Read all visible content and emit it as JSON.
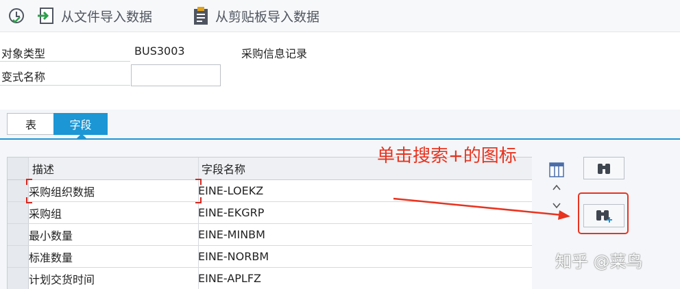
{
  "toolbar": {
    "import_file_label": "从文件导入数据",
    "import_clipboard_label": "从剪贴板导入数据",
    "icons": [
      "execute-icon",
      "import-file-icon",
      "clipboard-icon"
    ]
  },
  "form": {
    "object_type_label": "对象类型",
    "object_type_value": "BUS3003",
    "object_type_desc": "采购信息记录",
    "variant_name_label": "变式名称",
    "variant_name_value": ""
  },
  "tabs": [
    {
      "label": "表"
    },
    {
      "label": "字段",
      "active": true
    }
  ],
  "grid": {
    "columns": [
      "描述",
      "字段名称"
    ],
    "rows": [
      {
        "desc": "采购组织数据",
        "field": "EINE-LOEKZ"
      },
      {
        "desc": "采购组",
        "field": "EINE-EKGRP"
      },
      {
        "desc": "最小数量",
        "field": "EINE-MINBM"
      },
      {
        "desc": "标准数量",
        "field": "EINE-NORBM"
      },
      {
        "desc": "计划交货时间",
        "field": "EINE-APLFZ"
      }
    ]
  },
  "side_buttons": {
    "find_icon": "binoculars-icon",
    "find_next_icon": "binoculars-plus-icon"
  },
  "annotation": {
    "text": "单击搜索+的图标",
    "color": "#e8331f"
  },
  "watermark": "知乎 @菜鸟",
  "colors": {
    "accent": "#1c96d4",
    "annotation": "#e8331f"
  }
}
